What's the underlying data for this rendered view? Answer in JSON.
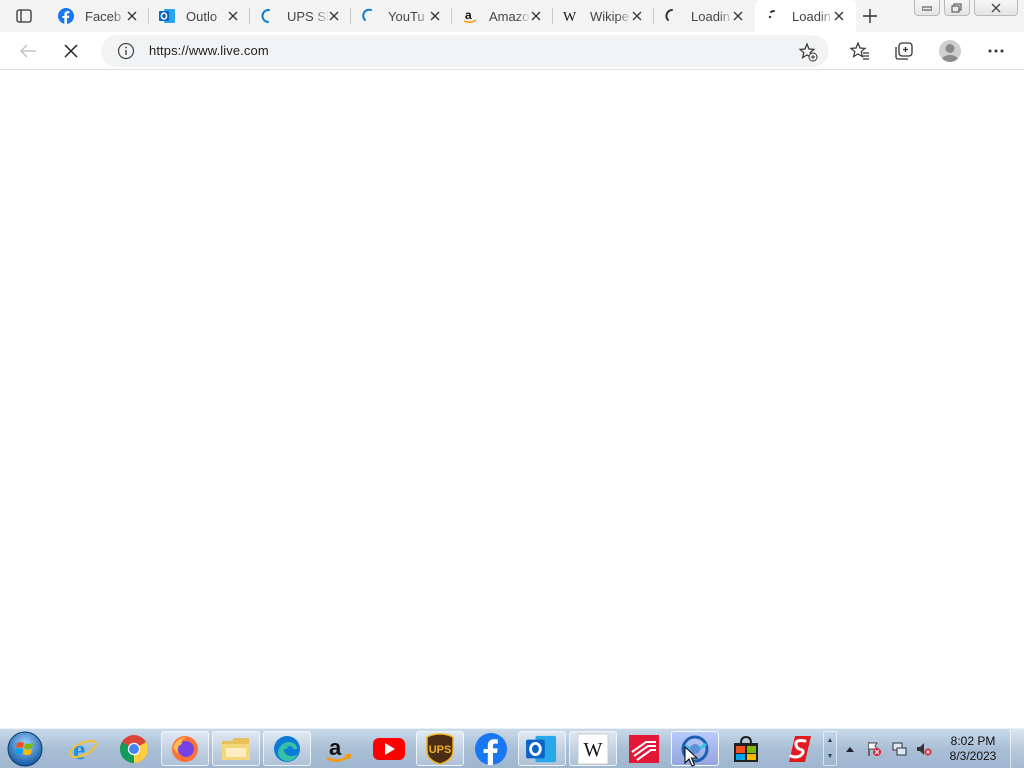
{
  "browser": {
    "tabs": [
      {
        "title": "Faceb",
        "icon": "facebook-icon"
      },
      {
        "title": "Outlo",
        "icon": "outlook-icon"
      },
      {
        "title": "UPS Sh",
        "icon": "loading-spinner-icon"
      },
      {
        "title": "YouTu",
        "icon": "loading-spinner-icon"
      },
      {
        "title": "Amazo",
        "icon": "amazon-icon"
      },
      {
        "title": "Wikipe",
        "icon": "wikipedia-icon"
      },
      {
        "title": "Loadin",
        "icon": "loading-spinner-icon"
      },
      {
        "title": "Loadin",
        "icon": "loading-spinner-icon",
        "active": true
      }
    ],
    "address": {
      "url": "https://www.live.com"
    },
    "colors": {
      "tabstrip": "#f3f3f3",
      "addressbar": "#f1f3f4",
      "edge_blue": "#0c7bd7"
    }
  },
  "taskbar": {
    "apps": [
      {
        "name": "internet-explorer",
        "icon": "internet-explorer-icon"
      },
      {
        "name": "chrome",
        "icon": "chrome-icon"
      },
      {
        "name": "firefox",
        "icon": "firefox-icon"
      },
      {
        "name": "file-explorer",
        "icon": "folder-icon"
      },
      {
        "name": "edge",
        "icon": "edge-icon"
      },
      {
        "name": "amazon",
        "icon": "amazon-icon"
      },
      {
        "name": "youtube",
        "icon": "youtube-icon"
      },
      {
        "name": "ups",
        "icon": "ups-icon",
        "label": "UPS"
      },
      {
        "name": "facebook",
        "icon": "facebook-icon"
      },
      {
        "name": "outlook",
        "icon": "outlook-icon"
      },
      {
        "name": "wikipedia",
        "icon": "wikipedia-icon",
        "label": "W"
      },
      {
        "name": "bank-of-america",
        "icon": "bank-of-america-icon"
      },
      {
        "name": "edge-active",
        "icon": "edge-globe-icon"
      },
      {
        "name": "store",
        "icon": "shopping-bag-icon"
      },
      {
        "name": "speedway",
        "icon": "speedway-icon"
      }
    ],
    "clock": {
      "time": "8:02 PM",
      "date": "8/3/2023"
    }
  }
}
